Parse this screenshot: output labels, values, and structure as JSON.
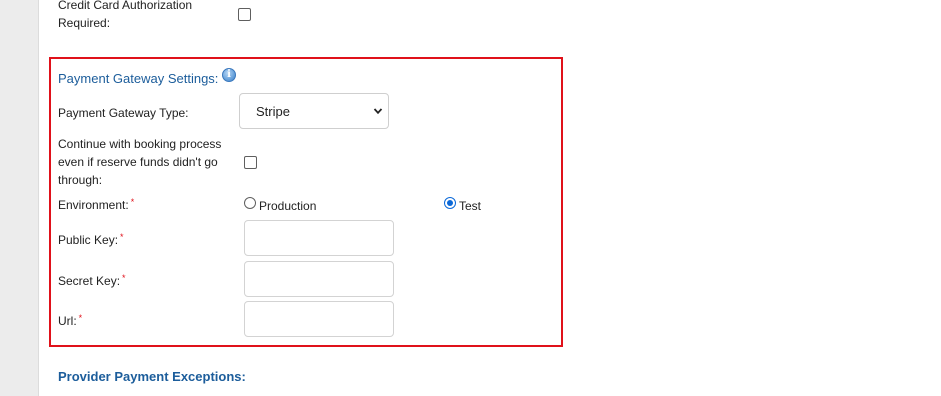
{
  "credit_card": {
    "label": "Credit Card Authorization Required:",
    "checked": false
  },
  "gateway": {
    "title": "Payment Gateway Settings:",
    "info_icon": "info-icon",
    "type_label": "Payment Gateway Type:",
    "type_value": "Stripe",
    "continue_label": "Continue with booking process even if reserve funds didn't go through:",
    "continue_checked": false,
    "environment_label": "Environment:",
    "environment_options": [
      "Production",
      "Test"
    ],
    "environment_selected": "Test",
    "public_key_label": "Public Key:",
    "public_key_value": "",
    "secret_key_label": "Secret Key:",
    "secret_key_value": "",
    "url_label": "Url:",
    "url_value": "",
    "required_marker": "*"
  },
  "exceptions": {
    "title": "Provider Payment Exceptions:"
  },
  "colors": {
    "highlight_border": "#e0111a",
    "section_title": "#1c5d9b",
    "radio_checked": "#0a68d8"
  }
}
